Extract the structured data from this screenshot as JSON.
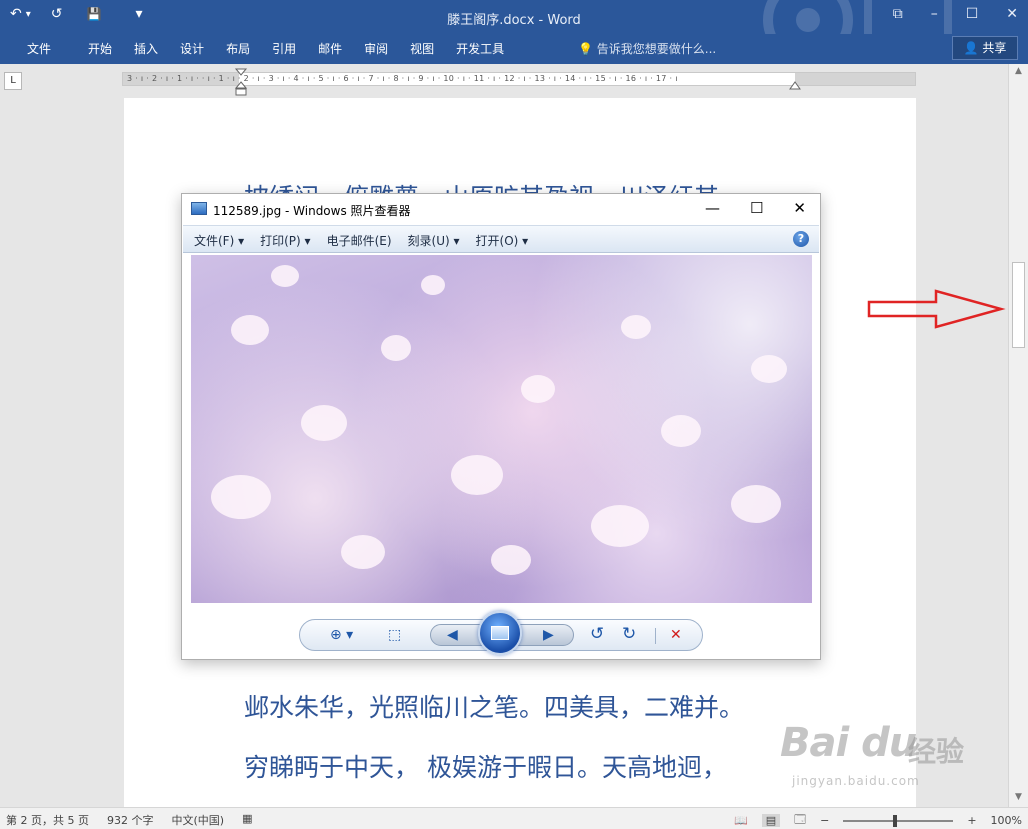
{
  "titlebar": {
    "title": "滕王阁序.docx - Word",
    "undo_icon": "↶",
    "undo_dropdown": "▾",
    "redo_icon": "↺",
    "save_icon": "💾",
    "customize_icon": "▾",
    "restore_icon": "⧉",
    "minimize_icon": "–",
    "maximize_icon": "☐",
    "close_icon": "✕"
  },
  "ribbon": {
    "tabs": [
      "文件",
      "开始",
      "插入",
      "设计",
      "布局",
      "引用",
      "邮件",
      "审阅",
      "视图",
      "开发工具"
    ],
    "tell_me": "告诉我您想要做什么...",
    "share": "共享"
  },
  "ruler": {
    "tab_selector": "L",
    "marks": "3 · ı · 2 · ı · 1 · ı ·   · ı · 1 · ı · 2 · ı · 3 · ı · 4 · ı · 5 · ı · 6 · ı · 7 · ı · 8 · ı · 9 · ı · 10 · ı · 11 · ı · 12 · ı · 13 · ı · 14 · ı · 15 · ı · 16 · ı · 17 · ı"
  },
  "document": {
    "line1": "披绣闼，俯雕甍，山原旷其盈视，川泽纡其",
    "line2": "邺水朱华，光照临川之笔。四美具，二难并。",
    "line3": "穷睇眄于中天， 极娱游于暇日。天高地迥，"
  },
  "viewer": {
    "title": "112589.jpg - Windows 照片查看器",
    "minimize": "—",
    "maximize": "☐",
    "close": "✕",
    "menu": [
      "文件(F)  ▾",
      "打印(P)  ▾",
      "电子邮件(E)",
      "刻录(U)  ▾",
      "打开(O)  ▾"
    ],
    "help": "?",
    "toolbar": {
      "zoom": "⊕ ▾",
      "fit": "⬚",
      "prev": "◀",
      "next": "▶",
      "rotate_left": "↺",
      "rotate_right": "↻",
      "delete": "✕"
    }
  },
  "statusbar": {
    "page": "第 2 页，共 5 页",
    "words": "932 个字",
    "language": "中文(中国)",
    "zoom": "100%",
    "zoom_out": "−",
    "zoom_in": "+"
  },
  "watermark": {
    "logo": "Bai  du",
    "cn": "经验",
    "url": "jingyan.baidu.com"
  }
}
